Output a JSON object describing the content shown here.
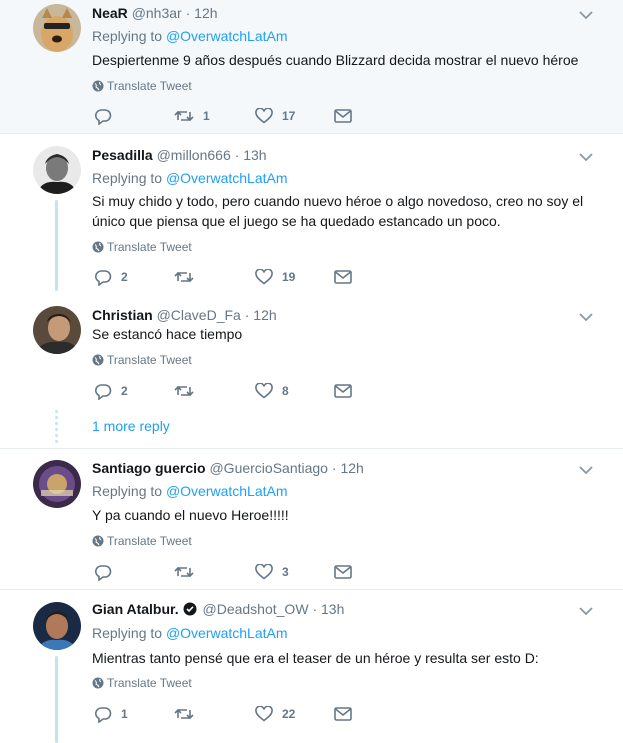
{
  "translate_label": "Translate Tweet",
  "replying_prefix": "Replying to",
  "tweets": [
    {
      "name": "NeaR",
      "handle": "@nh3ar",
      "dot": "·",
      "time": "12h",
      "replying_to": "@OverwatchLatAm",
      "text": "Despiertenme 9 años después cuando Blizzard  decida mostrar el nuevo héroe",
      "replies": "",
      "retweets": "1",
      "likes": "17"
    },
    {
      "name": "Pesadilla",
      "handle": "@millon666",
      "dot": "·",
      "time": "13h",
      "replying_to": "@OverwatchLatAm",
      "text": "Si muy chido y todo, pero cuando nuevo héroe o algo novedoso, creo no soy el único que piensa que el juego se ha quedado estancado un poco.",
      "replies": "2",
      "retweets": "",
      "likes": "19"
    },
    {
      "name": "Christian",
      "handle": "@ClaveD_Fa",
      "dot": "·",
      "time": "12h",
      "text": "Se estancó hace tiempo",
      "replies": "2",
      "retweets": "",
      "likes": "8"
    },
    {
      "name": "Santiago guercio",
      "handle": "@GuercioSantiago",
      "dot": "·",
      "time": "12h",
      "replying_to": "@OverwatchLatAm",
      "text": "Y pa cuando el nuevo Heroe!!!!!",
      "replies": "",
      "retweets": "",
      "likes": "3"
    },
    {
      "name": "Gian Atalbur.",
      "handle": "@Deadshot_OW",
      "dot": "·",
      "time": "13h",
      "replying_to": "@OverwatchLatAm",
      "text": "Mientras tanto pensé que era el teaser de un héroe y resulta ser esto D:",
      "replies": "1",
      "retweets": "",
      "likes": "22"
    }
  ],
  "more_replies": "1 more reply",
  "colors": {
    "accent": "#1da1f2",
    "muted": "#657786",
    "highlight_bg": "#f5f8fa",
    "thread_line": "#c4e2f6"
  },
  "icons": [
    "reply-icon",
    "retweet-icon",
    "like-icon",
    "dm-icon",
    "globe-icon",
    "chevron-down-icon",
    "verified-icon"
  ]
}
